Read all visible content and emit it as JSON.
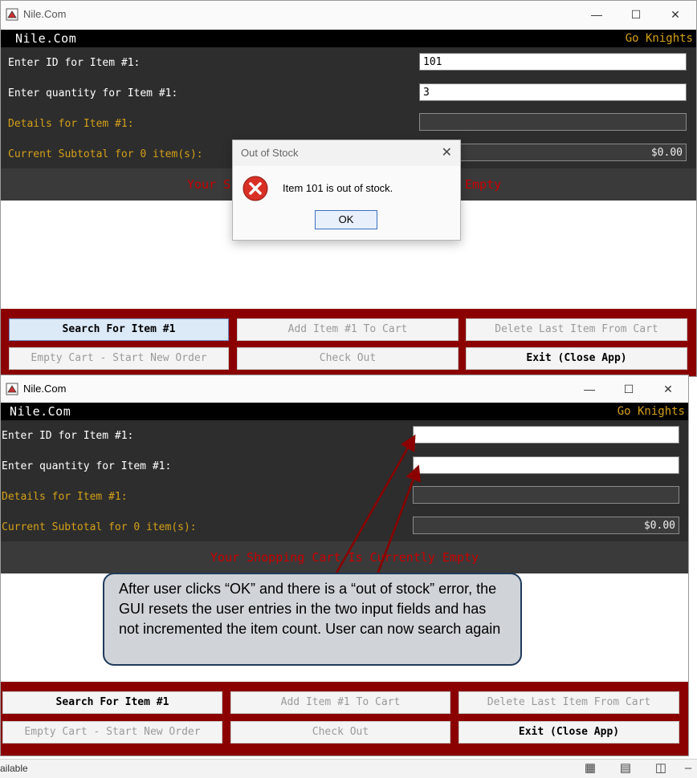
{
  "window1": {
    "title": "Nile.Com",
    "header": {
      "brand": "Nile.Com",
      "motto": "Go Knights"
    },
    "form": {
      "id_label": "Enter ID for Item #1:",
      "id_value": "101",
      "qty_label": "Enter quantity for Item #1:",
      "qty_value": "3",
      "details_label": "Details for Item #1:",
      "details_value": "",
      "subtotal_label": "Current Subtotal for 0 item(s):",
      "subtotal_value": "$0.00"
    },
    "cart_banner_left": "Your S",
    "cart_banner_right": "Empty",
    "buttons": {
      "search": "Search For Item #1",
      "add": "Add Item #1 To Cart",
      "delete_last": "Delete Last Item From Cart",
      "empty_cart": "Empty Cart - Start New Order",
      "check_out": "Check Out",
      "exit": "Exit (Close App)"
    }
  },
  "dialog": {
    "title": "Out of Stock",
    "message": "Item 101 is out of stock.",
    "ok_label": "OK"
  },
  "window2": {
    "title": "Nile.Com",
    "header": {
      "brand": "Nile.Com",
      "motto": "Go Knights"
    },
    "form": {
      "id_label": "Enter ID for Item #1:",
      "id_value": "",
      "qty_label": "Enter quantity for Item #1:",
      "qty_value": "",
      "details_label": "Details for Item #1:",
      "details_value": "",
      "subtotal_label": "Current Subtotal for 0 item(s):",
      "subtotal_value": "$0.00"
    },
    "cart_banner": "Your Shopping Cart Is Currently Empty",
    "buttons": {
      "search": "Search For Item #1",
      "add": "Add Item #1 To Cart",
      "delete_last": "Delete Last Item From Cart",
      "empty_cart": "Empty Cart - Start New Order",
      "check_out": "Check Out",
      "exit": "Exit (Close App)"
    }
  },
  "annotation": {
    "text": "After user clicks “OK” and there is a “out of stock” error, the GUI resets the user entries in the two input fields and has not incremented the item count. User can now search again"
  },
  "statusbar": {
    "text": "ailable"
  },
  "colors": {
    "header_bg": "#000000",
    "form_bg": "#2d2d2d",
    "accent_gold": "#d4a017",
    "banner_red": "#cc0000",
    "button_panel": "#8b0000",
    "callout_bg": "#d0d4d8",
    "arrow": "#8b0000"
  }
}
